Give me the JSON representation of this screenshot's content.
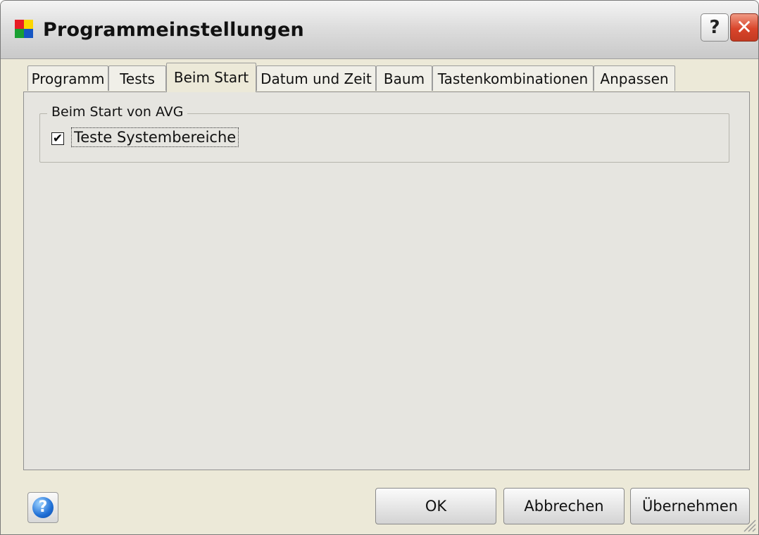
{
  "window": {
    "title": "Programmeinstellungen",
    "help_glyph": "?",
    "close_glyph": "✕",
    "logo_colors": [
      "#e81c24",
      "#fdd600",
      "#1aa032",
      "#1656c3"
    ]
  },
  "tabs": [
    {
      "label": "Programm",
      "active": false
    },
    {
      "label": "Tests",
      "active": false
    },
    {
      "label": "Beim Start",
      "active": true
    },
    {
      "label": "Datum und Zeit",
      "active": false
    },
    {
      "label": "Baum",
      "active": false
    },
    {
      "label": "Tastenkombinationen",
      "active": false
    },
    {
      "label": "Anpassen",
      "active": false
    }
  ],
  "group": {
    "legend": "Beim Start von AVG",
    "checkbox_label": "Teste Systembereiche",
    "checked": true,
    "check_glyph": "✔"
  },
  "footer": {
    "hint_icon": "question-circle-icon",
    "hint_glyph": "?",
    "ok_label": "OK",
    "cancel_label": "Abbrechen",
    "apply_label": "Übernehmen"
  }
}
